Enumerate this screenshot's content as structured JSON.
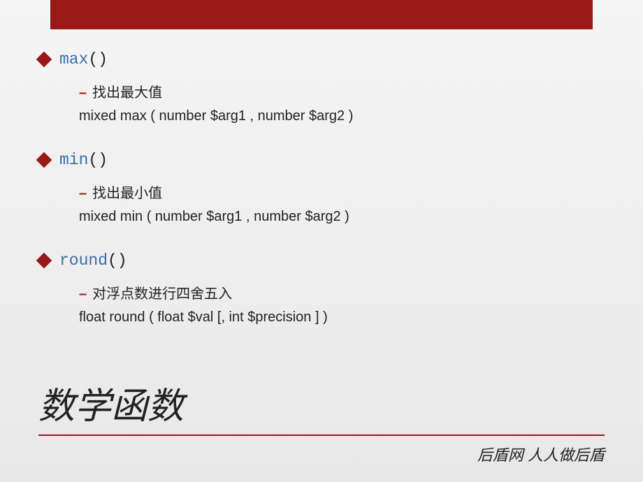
{
  "functions": [
    {
      "name": "max",
      "parens": "()",
      "description": "找出最大值",
      "signature": "mixed max ( number $arg1 , number $arg2 )"
    },
    {
      "name": "min",
      "parens": "()",
      "description": "找出最小值",
      "signature": "mixed min ( number $arg1 , number $arg2 )"
    },
    {
      "name": "round",
      "parens": "()",
      "description": "对浮点数进行四舍五入",
      "signature": "float round ( float $val [, int $precision ] )"
    }
  ],
  "title": "数学函数",
  "slogan": "后盾网 人人做后盾"
}
